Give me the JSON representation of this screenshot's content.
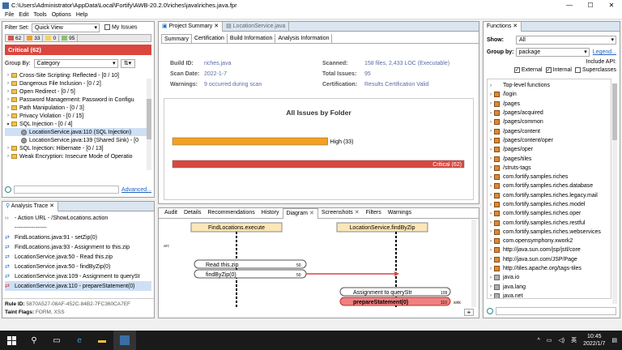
{
  "window": {
    "title": "C:\\Users\\Administrator\\AppData\\Local\\Fortify\\AWB-20.2.0\\riches\\java\\riches.java.fpr",
    "min": "—",
    "max": "☐",
    "close": "✕"
  },
  "menu": [
    "File",
    "Edit",
    "Tools",
    "Options",
    "Help"
  ],
  "left": {
    "filter_set_label": "Filter Set:",
    "filter_set_value": "Quick View",
    "my_issues": "My Issues",
    "counts": [
      {
        "v": "62",
        "c": "#d9534f"
      },
      {
        "v": "33",
        "c": "#f0a030"
      },
      {
        "v": "0",
        "c": "#f2d35a"
      },
      {
        "v": "95",
        "c": "#8bbf72"
      }
    ],
    "critical": "Critical (62)",
    "group_by_label": "Group By:",
    "group_by_value": "Category",
    "tree": [
      {
        "t": "Cross-Site Scripting: Reflected - [0 / 10]",
        "lvl": 0,
        "k": "box"
      },
      {
        "t": "Dangerous File Inclusion - [0 / 2]",
        "lvl": 0,
        "k": "box"
      },
      {
        "t": "Open Redirect - [0 / 5]",
        "lvl": 0,
        "k": "box"
      },
      {
        "t": "Password Management: Password in Configu",
        "lvl": 0,
        "k": "box"
      },
      {
        "t": "Path Manipulation - [0 / 3]",
        "lvl": 0,
        "k": "box"
      },
      {
        "t": "Privacy Violation - [0 / 15]",
        "lvl": 0,
        "k": "box"
      },
      {
        "t": "SQL Injection - [0 / 4]",
        "lvl": 0,
        "k": "box",
        "open": true
      },
      {
        "t": "LocationService.java:110 (SQL Injection)",
        "lvl": 1,
        "k": "gear",
        "sel": true
      },
      {
        "t": "LocationService.java:139 (Shared Sink) - [0",
        "lvl": 1,
        "k": "gear"
      },
      {
        "t": "SQL Injection: Hibernate - [0 / 13]",
        "lvl": 0,
        "k": "box"
      },
      {
        "t": "Weak Encryption: Insecure Mode of Operatio",
        "lvl": 0,
        "k": "box"
      }
    ],
    "advanced": "Advanced...",
    "trace_title": "Analysis Trace",
    "trace": [
      {
        "t": "- Action URL - /ShowLocations.action",
        "k": "arrow"
      },
      {
        "t": "-----------------",
        "k": "none"
      },
      {
        "t": "FindLocations.java:91 - setZip(0)",
        "k": "o"
      },
      {
        "t": "FindLocations.java:93 - Assignment to this.zip",
        "k": "o"
      },
      {
        "t": "LocationService.java:50 - Read this.zip",
        "k": "o"
      },
      {
        "t": "LocationService.java:50 - findByZip(0)",
        "k": "o"
      },
      {
        "t": "LocationService.java:109 - Assignment to querySt",
        "k": "o"
      },
      {
        "t": "LocationService.java:110 - prepareStatement(0)",
        "k": "r"
      }
    ],
    "rule_id_label": "Rule ID:",
    "rule_id": "5870A527-08AF-452C-84B2-7FC360CA7EF",
    "taint_label": "Taint Flags:",
    "taint": "FORM, XSS"
  },
  "center": {
    "tabs": [
      "Project Summary",
      "LocationService.java"
    ],
    "subtabs": [
      "Summary",
      "Certification",
      "Build Information",
      "Analysis Information"
    ],
    "build_id_l": "Build ID:",
    "build_id": "riches.java",
    "scan_date_l": "Scan Date:",
    "scan_date": "2022-1-7",
    "warnings_l": "Warnings:",
    "warnings": "9 occurred during scan",
    "scanned_l": "Scanned:",
    "scanned": "158 files, 2,433 LOC (Executable)",
    "total_l": "Total Issues:",
    "total": "95",
    "cert_l": "Certification:",
    "cert": "Results Certification Valid",
    "chart_title": "All Issues by Folder",
    "bottom_tabs": [
      "Audit",
      "Details",
      "Recommendations",
      "History",
      "Diagram",
      "Screenshots",
      "Filters",
      "Warnings"
    ],
    "diagram": {
      "left_head": "FindLocations.execute",
      "right_head": "LocationService.findByZip",
      "arc": "arc",
      "n1": "Read this.zip",
      "n1v": "50",
      "n2": "findByZip(0)",
      "n2v": "50",
      "n3": "Assignment to queryStr",
      "n3v": "109",
      "n4": "prepareStatement(0)",
      "n4v": "110",
      "sink": "sink"
    }
  },
  "chart_data": {
    "type": "bar",
    "categories": [
      "High (33)",
      "Critical (62)"
    ],
    "values": [
      33,
      62
    ],
    "title": "All Issues by Folder",
    "colors": [
      "#f5a022",
      "#d9473e"
    ]
  },
  "right": {
    "title": "Functions",
    "show_l": "Show:",
    "show_v": "All",
    "groupby_l": "Group by:",
    "groupby_v": "package",
    "legend": "Legend...",
    "include_api": "Include API:",
    "external": "External",
    "internal": "Internal",
    "superclasses": "Superclasses",
    "items": [
      {
        "t": "Top-level functions",
        "k": "none"
      },
      {
        "t": "/login",
        "k": "pkg"
      },
      {
        "t": "/pages",
        "k": "pkg"
      },
      {
        "t": "/pages/acquired",
        "k": "pkg"
      },
      {
        "t": "/pages/common",
        "k": "pkg"
      },
      {
        "t": "/pages/content",
        "k": "pkg"
      },
      {
        "t": "/pages/content/oper",
        "k": "pkg"
      },
      {
        "t": "/pages/oper",
        "k": "pkg"
      },
      {
        "t": "/pages/tiles",
        "k": "pkg"
      },
      {
        "t": "/struts-tags",
        "k": "pkg"
      },
      {
        "t": "com.fortify.samples.riches",
        "k": "pkg"
      },
      {
        "t": "com.fortify.samples.riches.database",
        "k": "pkg"
      },
      {
        "t": "com.fortify.samples.riches.legacy.mail",
        "k": "pkg"
      },
      {
        "t": "com.fortify.samples.riches.model",
        "k": "pkg"
      },
      {
        "t": "com.fortify.samples.riches.oper",
        "k": "pkg"
      },
      {
        "t": "com.fortify.samples.riches.restful",
        "k": "pkg"
      },
      {
        "t": "com.fortify.samples.riches.webservices",
        "k": "pkg"
      },
      {
        "t": "com.opensymphony.xwork2",
        "k": "pkg"
      },
      {
        "t": "http://java.sun.com/jsp/jstl/core",
        "k": "pkg"
      },
      {
        "t": "http://java.sun.com/JSP/Page",
        "k": "pkg"
      },
      {
        "t": "http://tiles.apache.org/tags-tiles",
        "k": "pkg"
      },
      {
        "t": "java.io",
        "k": "jar"
      },
      {
        "t": "java.lang",
        "k": "jar"
      },
      {
        "t": "java.net",
        "k": "jar"
      }
    ]
  },
  "taskbar": {
    "time": "10:45",
    "date": "2022/1/7",
    "lang": "英"
  }
}
